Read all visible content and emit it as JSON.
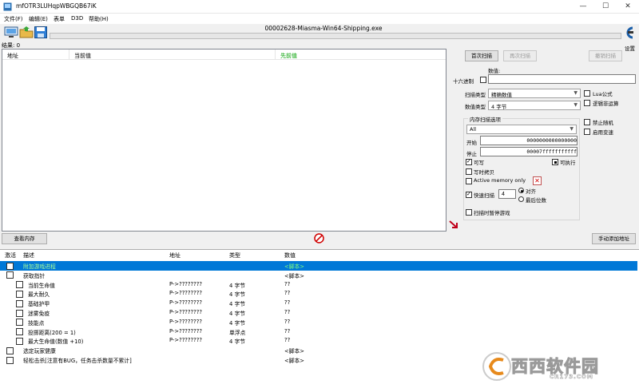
{
  "window": {
    "title": "mfOTR3LUHqpWBGQB67iK",
    "minimize": "—",
    "maximize": "☐",
    "close": "✕"
  },
  "menu": [
    "文件(F)",
    "编辑(E)",
    "表单",
    "D3D",
    "帮助(H)"
  ],
  "toolbar": {
    "process_name": "00002628-Miasma-Win64-Shipping.exe",
    "settings_label": "设置"
  },
  "results": {
    "label": "结果: 0",
    "columns": [
      "地址",
      "当前值",
      "先前值"
    ]
  },
  "scan": {
    "first_scan": "首次扫描",
    "next_scan": "再次扫描",
    "undo_scan": "撤销扫描",
    "value_label": "数值:",
    "hex_label": "十六进制",
    "hex_checked": false,
    "value": "",
    "scan_type_label": "扫描类型",
    "scan_type": "精确数值",
    "value_type_label": "数值类型",
    "value_type": "4 字节",
    "lua_label": "Lua公式",
    "lua_checked": false,
    "not_label": "逻辑非运算",
    "not_checked": false,
    "memory_options_label": "内存扫描选项",
    "region": "All",
    "start_label": "开始",
    "start_value": "0000000000000000",
    "stop_label": "停止",
    "stop_value": "00007fffffffffff",
    "writable_label": "可写",
    "writable_checked": true,
    "executable_label": "可执行",
    "executable_checked": true,
    "copy_on_write_label": "写时拷贝",
    "copy_on_write_checked": false,
    "active_memory_label": "Active memory only",
    "active_memory_checked": false,
    "fast_scan_label": "快速扫描",
    "fast_scan_checked": true,
    "fast_scan_value": "4",
    "align_label": "对齐",
    "align_selected": true,
    "last_digits_label": "最后位数",
    "last_digits_selected": false,
    "pause_label": "扫描时暂停游戏",
    "pause_checked": false,
    "disable_random_label": "禁止随机",
    "disable_random_checked": false,
    "speedhack_label": "启用变速",
    "speedhack_checked": false
  },
  "bottom": {
    "view_memory": "查看内存",
    "add_address": "手动添加地址"
  },
  "table": {
    "columns": [
      "激活",
      "描述",
      "地址",
      "类型",
      "数值"
    ],
    "rows": [
      {
        "desc": "附加游戏进程",
        "addr": "",
        "type": "",
        "value": "<脚本>",
        "indent": 0,
        "selected": true
      },
      {
        "desc": "获取指针",
        "addr": "",
        "type": "",
        "value": "<脚本>",
        "indent": 0,
        "selected": false
      },
      {
        "desc": "当前生命值",
        "addr": "P->????????",
        "type": "4 字节",
        "value": "??",
        "indent": 1,
        "selected": false
      },
      {
        "desc": "最大耐久",
        "addr": "P->????????",
        "type": "4 字节",
        "value": "??",
        "indent": 1,
        "selected": false
      },
      {
        "desc": "基础护甲",
        "addr": "P->????????",
        "type": "4 字节",
        "value": "??",
        "indent": 1,
        "selected": false
      },
      {
        "desc": "迷雾免疫",
        "addr": "P->????????",
        "type": "4 字节",
        "value": "??",
        "indent": 1,
        "selected": false
      },
      {
        "desc": "技能点",
        "addr": "P->????????",
        "type": "4 字节",
        "value": "??",
        "indent": 1,
        "selected": false
      },
      {
        "desc": "投掷距离(200 = 1)",
        "addr": "P->????????",
        "type": "单浮点",
        "value": "??",
        "indent": 1,
        "selected": false
      },
      {
        "desc": "最大生命值(数值 +10)",
        "addr": "P->????????",
        "type": "4 字节",
        "value": "??",
        "indent": 1,
        "selected": false
      },
      {
        "desc": "选定玩家健康",
        "addr": "",
        "type": "",
        "value": "<脚本>",
        "indent": 0,
        "selected": false
      },
      {
        "desc": "轻松击杀[注意有BUG，任务击杀数量不累计]",
        "addr": "",
        "type": "",
        "value": "<脚本>",
        "indent": 0,
        "selected": false
      }
    ]
  },
  "watermark": {
    "brand": "西西软件园",
    "url": "CR173.COM"
  },
  "colors": {
    "selection": "#0078d7",
    "script_green": "#00c800",
    "accent_green": "#00a000"
  }
}
